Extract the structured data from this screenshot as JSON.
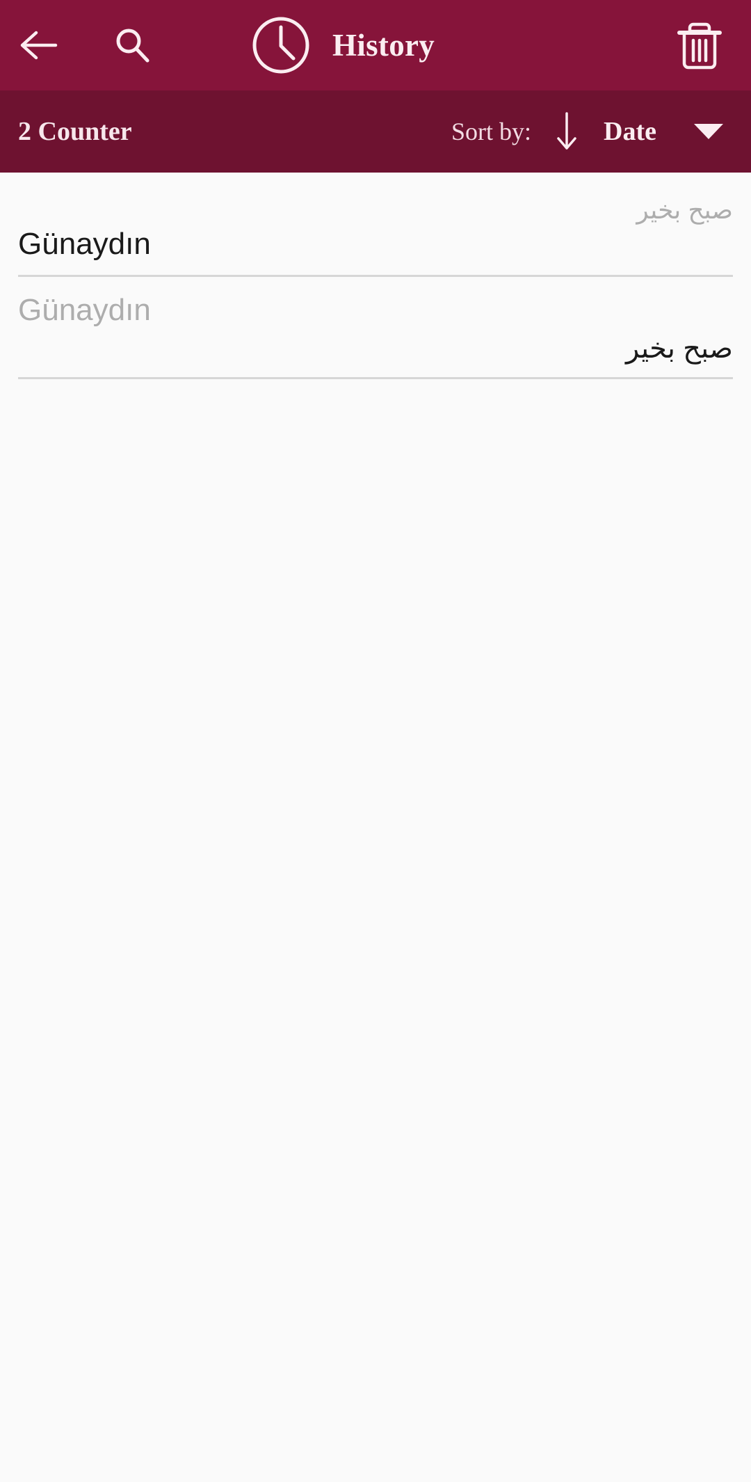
{
  "app_bar": {
    "back_icon": "arrow-left-icon",
    "search_icon": "search-icon",
    "clock_icon": "clock-icon",
    "title": "History",
    "delete_icon": "trash-icon",
    "background_color": "#86143A"
  },
  "sort_bar": {
    "counter_label": "2 Counter",
    "sort_by_label": "Sort by:",
    "sort_direction_icon": "arrow-down-icon",
    "sort_field_label": "Date",
    "dropdown_icon": "caret-down-icon",
    "background_color": "#6E1230"
  },
  "history": {
    "items": [
      {
        "secondary_text": "صبح بخير",
        "secondary_dir": "rtl",
        "primary_text": "Günaydın",
        "primary_dir": "ltr"
      },
      {
        "secondary_text": "Günaydın",
        "secondary_dir": "ltr",
        "primary_text": "صبح بخير",
        "primary_dir": "rtl"
      }
    ]
  },
  "colors": {
    "page_background": "#FAFAFA",
    "divider": "#D6D6D6",
    "primary_text": "#1A1A1A",
    "secondary_text": "#ADADAD",
    "on_primary": "#FBEDF1"
  }
}
